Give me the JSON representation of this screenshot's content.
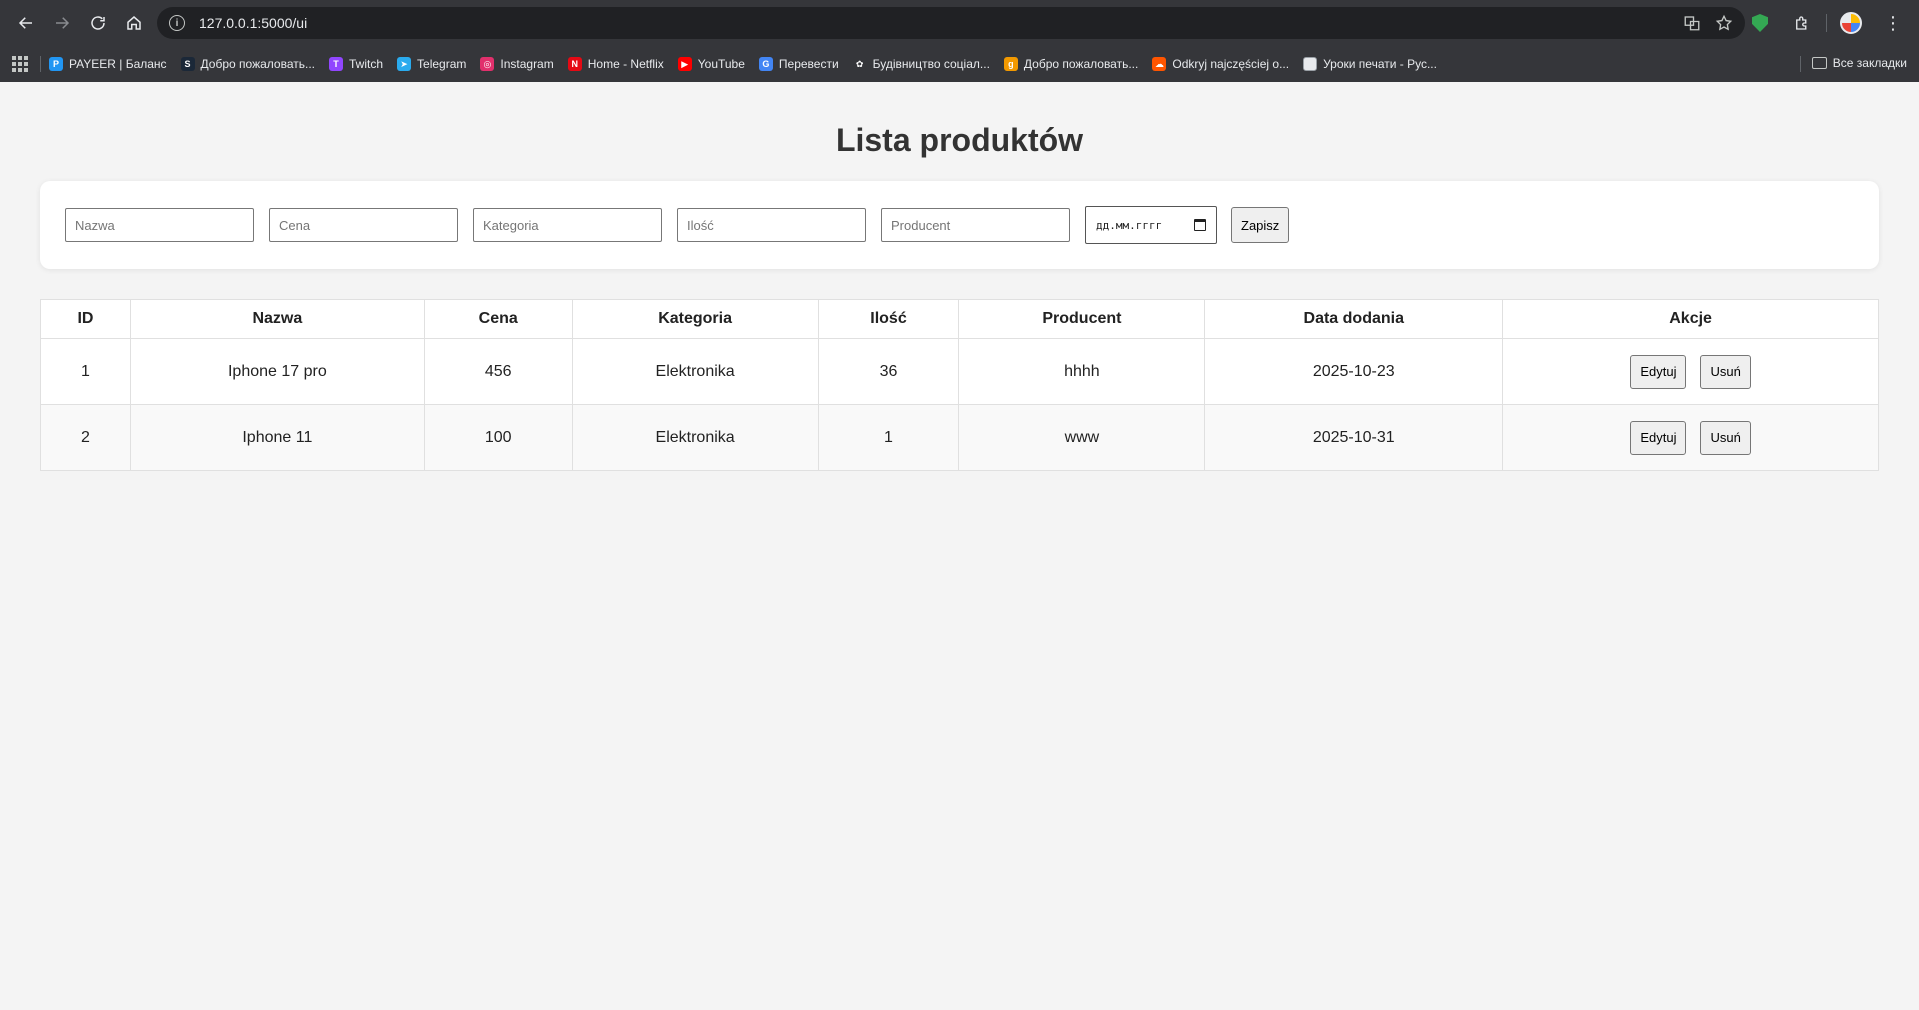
{
  "browser": {
    "url": "127.0.0.1:5000/ui",
    "bookmarks": [
      {
        "label": "PAYEER | Баланс",
        "icon": "payeer-icon",
        "color": "#2196f3",
        "glyph": "P"
      },
      {
        "label": "Добро пожаловать...",
        "icon": "steam-icon",
        "color": "#1b2838",
        "glyph": "S"
      },
      {
        "label": "Twitch",
        "icon": "twitch-icon",
        "color": "#9146ff",
        "glyph": "T"
      },
      {
        "label": "Telegram",
        "icon": "telegram-icon",
        "color": "#2aabee",
        "glyph": "➤"
      },
      {
        "label": "Instagram",
        "icon": "instagram-icon",
        "color": "#e1306c",
        "glyph": "◎"
      },
      {
        "label": "Home - Netflix",
        "icon": "netflix-icon",
        "color": "#e50914",
        "glyph": "N"
      },
      {
        "label": "YouTube",
        "icon": "youtube-icon",
        "color": "#ff0000",
        "glyph": "▶"
      },
      {
        "label": "Перевести",
        "icon": "translate-icon",
        "color": "#4285f4",
        "glyph": "G"
      },
      {
        "label": "Будівництво соціал...",
        "icon": "openai-icon",
        "color": "#35363a",
        "glyph": "✿"
      },
      {
        "label": "Добро пожаловать...",
        "icon": "g-icon",
        "color": "#f29900",
        "glyph": "g"
      },
      {
        "label": "Odkryj najczęściej o...",
        "icon": "soundcloud-icon",
        "color": "#ff5500",
        "glyph": "☁"
      },
      {
        "label": "Уроки печати - Рус...",
        "icon": "page-icon",
        "color": "#e8eaed",
        "glyph": ""
      }
    ],
    "all_bookmarks": "Все закладки"
  },
  "page": {
    "title": "Lista produktów",
    "form": {
      "nazwa_placeholder": "Nazwa",
      "cena_placeholder": "Cena",
      "kategoria_placeholder": "Kategoria",
      "ilosc_placeholder": "Ilość",
      "producent_placeholder": "Producent",
      "date_placeholder": "дд.мм.гггг",
      "submit_label": "Zapisz"
    },
    "table": {
      "headers": [
        "ID",
        "Nazwa",
        "Cena",
        "Kategoria",
        "Ilość",
        "Producent",
        "Data dodania",
        "Akcje"
      ],
      "rows": [
        {
          "id": "1",
          "nazwa": "Iphone 17 pro",
          "cena": "456",
          "kategoria": "Elektronika",
          "ilosc": "36",
          "producent": "hhhh",
          "data": "2025-10-23"
        },
        {
          "id": "2",
          "nazwa": "Iphone 11",
          "cena": "100",
          "kategoria": "Elektronika",
          "ilosc": "1",
          "producent": "www",
          "data": "2025-10-31"
        }
      ],
      "edit_label": "Edytuj",
      "delete_label": "Usuń"
    }
  }
}
